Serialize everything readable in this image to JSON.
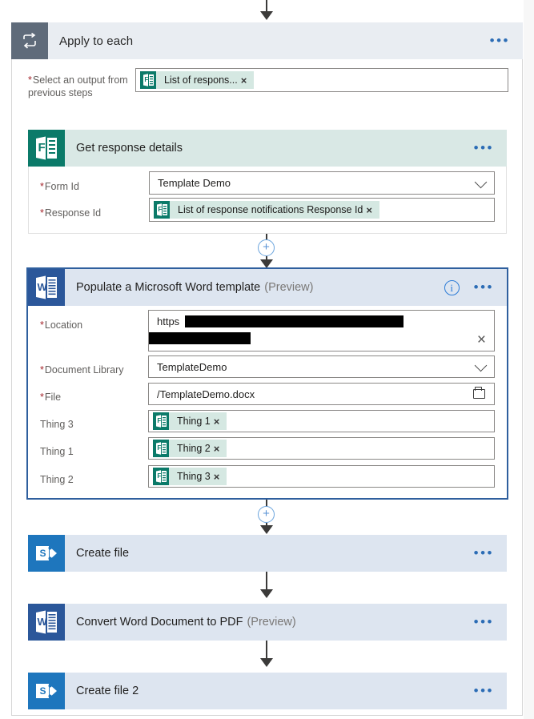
{
  "flow": {
    "scope": {
      "title": "Apply to each",
      "icon": "loop-icon",
      "menu": "•••",
      "input": {
        "label": "Select an output from previous steps",
        "required": true,
        "token": {
          "text": "List of respons...",
          "icon": "forms-icon",
          "remove": "×"
        }
      }
    },
    "actions": [
      {
        "id": "get-response-details",
        "title": "Get response details",
        "preview": "",
        "icon": "forms-icon",
        "menu": "•••",
        "selected": false,
        "fields": [
          {
            "label": "Form Id",
            "required": true,
            "type": "dropdown",
            "value": "Template Demo"
          },
          {
            "label": "Response Id",
            "required": true,
            "type": "token",
            "token": {
              "text": "List of response notifications Response Id",
              "icon": "forms-icon",
              "remove": "×"
            }
          }
        ]
      },
      {
        "id": "populate-word-template",
        "title": "Populate a Microsoft Word template",
        "preview": "(Preview)",
        "icon": "word-icon",
        "info": "i",
        "menu": "•••",
        "selected": true,
        "fields": [
          {
            "label": "Location",
            "required": true,
            "type": "text-redacted",
            "value": "https",
            "clear": "×"
          },
          {
            "label": "Document Library",
            "required": true,
            "type": "dropdown",
            "value": "TemplateDemo"
          },
          {
            "label": "File",
            "required": true,
            "type": "file-picker",
            "value": "/TemplateDemo.docx"
          },
          {
            "label": "Thing 3",
            "required": false,
            "type": "token",
            "token": {
              "text": "Thing 1",
              "icon": "forms-icon",
              "remove": "×"
            }
          },
          {
            "label": "Thing 1",
            "required": false,
            "type": "token",
            "token": {
              "text": "Thing 2",
              "icon": "forms-icon",
              "remove": "×"
            }
          },
          {
            "label": "Thing 2",
            "required": false,
            "type": "token",
            "token": {
              "text": "Thing 3",
              "icon": "forms-icon",
              "remove": "×"
            }
          }
        ]
      },
      {
        "id": "create-file",
        "title": "Create file",
        "preview": "",
        "icon": "sharepoint-icon",
        "menu": "•••",
        "selected": false,
        "fields": []
      },
      {
        "id": "convert-word-to-pdf",
        "title": "Convert Word Document to PDF",
        "preview": "(Preview)",
        "icon": "word-icon",
        "menu": "•••",
        "selected": false,
        "fields": []
      },
      {
        "id": "create-file-2",
        "title": "Create file 2",
        "preview": "",
        "icon": "sharepoint-icon",
        "menu": "•••",
        "selected": false,
        "fields": []
      }
    ],
    "insert_button": {
      "label": "+",
      "name": "add-step-button"
    },
    "colors": {
      "forms_green": "#0B7A69",
      "word_blue": "#2B579A",
      "sharepoint_blue": "#1E76BD",
      "scope_gray": "#5F6B7A",
      "card_header_blue": "#dde5f0",
      "card_header_teal": "#d9e8e5",
      "accent_blue": "#2b6cb5",
      "selected_border": "#2f5f9e",
      "required_red": "#a4262c"
    }
  }
}
